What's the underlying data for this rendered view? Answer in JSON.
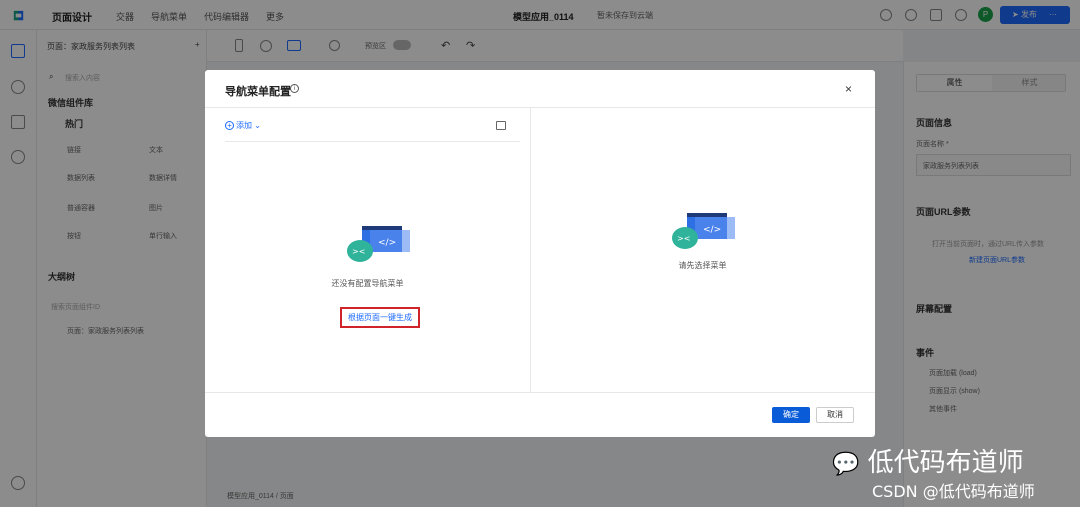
{
  "topbar": {
    "title": "页面设计",
    "tabs": [
      "交器",
      "导航菜单",
      "代码编辑器",
      "更多"
    ],
    "app_name": "模型应用_0114",
    "save_status": "暂未保存到云端",
    "publish": "发布",
    "avatar": "P"
  },
  "left": {
    "page_select": "页面：家政服务列表列表",
    "search_placeholder": "搜索入内容",
    "lib_title": "微信组件库",
    "hot": "热门",
    "components": [
      "链接",
      "文本",
      "数据列表",
      "数据详情",
      "普通容器",
      "图片",
      "按钮",
      "单行输入"
    ],
    "outline_title": "大纲树",
    "outline_search": "搜索页面组件ID",
    "tree_item": "页面：家政服务列表列表"
  },
  "toolbar": {
    "preview": "预览区"
  },
  "right": {
    "tabs": [
      "属性",
      "样式"
    ],
    "page_info": "页面信息",
    "page_name_label": "页面名称 *",
    "page_name_value": "家政服务列表列表",
    "url_title": "页面URL参数",
    "url_desc": "打开当前页面时，通过URL传入参数",
    "url_add": "新建页面URL参数",
    "screen_title": "屏幕配置",
    "events_title": "事件",
    "events": [
      "页面加载 (load)",
      "页面显示 (show)",
      "其他事件"
    ]
  },
  "breadcrumb": "模型应用_0114 / 页面",
  "modal": {
    "title": "导航菜单配置",
    "add": "添加",
    "empty_left": "还没有配置导航菜单",
    "generate": "根据页面一键生成",
    "empty_right": "请先选择菜单",
    "ok": "确定",
    "cancel": "取消"
  },
  "watermark": {
    "main": "低代码布道师",
    "sub": "CSDN @低代码布道师"
  },
  "colors": {
    "primary": "#1e6bff",
    "highlight": "#d0232a",
    "publish": "#1e6bff"
  }
}
